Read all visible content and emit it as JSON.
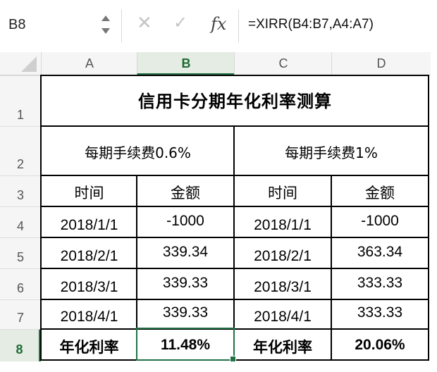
{
  "formula_bar": {
    "name_box": "B8",
    "fx_label": "fx",
    "formula": "=XIRR(B4:B7,A4:A7)",
    "cancel_icon": "close-icon",
    "enter_icon": "check-icon"
  },
  "columns": [
    "A",
    "B",
    "C",
    "D"
  ],
  "selected_column": "B",
  "rows": [
    "1",
    "2",
    "3",
    "4",
    "5",
    "6",
    "7",
    "8"
  ],
  "selected_row": "8",
  "sheet": {
    "title": "信用卡分期年化利率测算",
    "section_left": "每期手续费0.6%",
    "section_right": "每期手续费1%",
    "header_time_left": "时间",
    "header_amount_left": "金额",
    "header_time_right": "时间",
    "header_amount_right": "金额",
    "left_dates": [
      "2018/1/1",
      "2018/2/1",
      "2018/3/1",
      "2018/4/1"
    ],
    "left_amounts": [
      "-1000",
      "339.34",
      "339.33",
      "339.33"
    ],
    "right_dates": [
      "2018/1/1",
      "2018/2/1",
      "2018/3/1",
      "2018/4/1"
    ],
    "right_amounts": [
      "-1000",
      "363.34",
      "333.33",
      "333.33"
    ],
    "result_label_left": "年化利率",
    "result_value_left": "11.48%",
    "result_label_right": "年化利率",
    "result_value_right": "20.06%"
  },
  "colors": {
    "selection_green": "#217346",
    "header_bg": "#f5f5f5"
  }
}
